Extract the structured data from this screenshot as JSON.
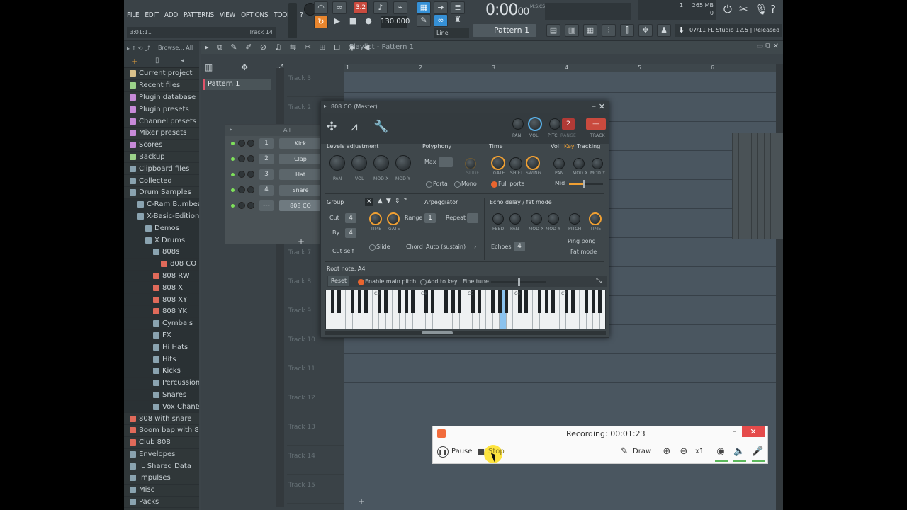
{
  "menu": [
    "FILE",
    "EDIT",
    "ADD",
    "PATTERNS",
    "VIEW",
    "OPTIONS",
    "TOOLS",
    "?"
  ],
  "hint": {
    "time": "3:01:11",
    "track": "Track 14"
  },
  "transport": {
    "bpm": "130.000",
    "snap_mode": "Line",
    "pattern": "Pattern 1",
    "counter": "0:00",
    "counter_fraction": "00",
    "counter_unit": "M:S:CS"
  },
  "memory": {
    "used": "265 MB",
    "count": "1",
    "zero": "0"
  },
  "news": {
    "date": "07/11",
    "text": "FL Studio 12.5 | Released"
  },
  "browser": {
    "toolbar_label": "Browse... All",
    "items": [
      {
        "label": "Current project",
        "indent": 0,
        "color": "#d9c08a"
      },
      {
        "label": "Recent files",
        "indent": 0,
        "color": "#9cd38a"
      },
      {
        "label": "Plugin database",
        "indent": 0,
        "color": "#c78ad9"
      },
      {
        "label": "Plugin presets",
        "indent": 0,
        "color": "#c78ad9"
      },
      {
        "label": "Channel presets",
        "indent": 0,
        "color": "#c78ad9"
      },
      {
        "label": "Mixer presets",
        "indent": 0,
        "color": "#c78ad9"
      },
      {
        "label": "Scores",
        "indent": 0,
        "color": "#c78ad9"
      },
      {
        "label": "Backup",
        "indent": 0,
        "color": "#9cd38a"
      },
      {
        "label": "Clipboard files",
        "indent": 0,
        "color": "#8aa3b0"
      },
      {
        "label": "Collected",
        "indent": 0,
        "color": "#8aa3b0"
      },
      {
        "label": "Drum Samples",
        "indent": 0,
        "color": "#8aa3b0"
      },
      {
        "label": "C-Ram B..mbeatz",
        "indent": 1,
        "color": "#8aa3b0"
      },
      {
        "label": "X-Basic-Edition",
        "indent": 1,
        "color": "#8aa3b0"
      },
      {
        "label": "Demos",
        "indent": 2,
        "color": "#8aa3b0"
      },
      {
        "label": "X Drums",
        "indent": 2,
        "color": "#8aa3b0"
      },
      {
        "label": "808s",
        "indent": 3,
        "color": "#8aa3b0"
      },
      {
        "label": "808 CO",
        "indent": 4,
        "color": "#e06a5a"
      },
      {
        "label": "808 RW",
        "indent": 3,
        "color": "#e06a5a"
      },
      {
        "label": "808 X",
        "indent": 3,
        "color": "#e06a5a"
      },
      {
        "label": "808 XY",
        "indent": 3,
        "color": "#e06a5a"
      },
      {
        "label": "808 YK",
        "indent": 3,
        "color": "#e06a5a"
      },
      {
        "label": "Cymbals",
        "indent": 3,
        "color": "#8aa3b0"
      },
      {
        "label": "FX",
        "indent": 3,
        "color": "#8aa3b0"
      },
      {
        "label": "Hi Hats",
        "indent": 3,
        "color": "#8aa3b0"
      },
      {
        "label": "Hits",
        "indent": 3,
        "color": "#8aa3b0"
      },
      {
        "label": "Kicks",
        "indent": 3,
        "color": "#8aa3b0"
      },
      {
        "label": "Percussion",
        "indent": 3,
        "color": "#8aa3b0"
      },
      {
        "label": "Snares",
        "indent": 3,
        "color": "#8aa3b0"
      },
      {
        "label": "Vox Chants",
        "indent": 3,
        "color": "#8aa3b0"
      },
      {
        "label": "808 with snare",
        "indent": 0,
        "color": "#e06a5a"
      },
      {
        "label": "Boom bap with 808",
        "indent": 0,
        "color": "#e06a5a"
      },
      {
        "label": "Club 808",
        "indent": 0,
        "color": "#e06a5a"
      },
      {
        "label": "Envelopes",
        "indent": 0,
        "color": "#8aa3b0"
      },
      {
        "label": "IL Shared Data",
        "indent": 0,
        "color": "#8aa3b0"
      },
      {
        "label": "Impulses",
        "indent": 0,
        "color": "#8aa3b0"
      },
      {
        "label": "Misc",
        "indent": 0,
        "color": "#8aa3b0"
      },
      {
        "label": "Packs",
        "indent": 0,
        "color": "#8aa3b0"
      }
    ]
  },
  "playlist": {
    "title": "Playlist - Pattern 1",
    "pattern_item": "Pattern 1",
    "ruler": [
      "1",
      "2",
      "3",
      "4",
      "5",
      "6"
    ],
    "tracks": [
      "Track 3",
      "Track 2",
      "",
      "",
      "",
      "",
      "Track 7",
      "Track 8",
      "Track 9",
      "Track 10",
      "Track 11",
      "Track 12",
      "Track 13",
      "Track 14",
      "Track 15"
    ]
  },
  "rack": {
    "filter": "All",
    "channels": [
      {
        "num": "1",
        "name": "Kick"
      },
      {
        "num": "2",
        "name": "Clap"
      },
      {
        "num": "3",
        "name": "Hat"
      },
      {
        "num": "4",
        "name": "Snare"
      },
      {
        "num": "---",
        "name": "808 CO"
      }
    ],
    "add": "+"
  },
  "plugin": {
    "title": "808 CO (Master)",
    "header_knobs": [
      "PAN",
      "VOL",
      "PITCH",
      "RANGE",
      "TRACK"
    ],
    "range_value": "2",
    "track_value": "---",
    "levels": {
      "title": "Levels adjustment",
      "knobs": [
        "PAN",
        "VOL",
        "MOD X",
        "MOD Y"
      ]
    },
    "polyphony": {
      "title": "Polyphony",
      "max_label": "Max",
      "slide_label": "SLIDE",
      "porta": "Porta",
      "mono": "Mono"
    },
    "time": {
      "title": "Time",
      "knobs": [
        "GATE",
        "SHIFT",
        "SWING"
      ],
      "full_porta": "Full porta"
    },
    "tracking": {
      "tabs": [
        "Vol",
        "Key",
        "Tracking"
      ],
      "knobs": [
        "PAN",
        "MOD X",
        "MOD Y"
      ],
      "mid": "Mid"
    },
    "group": {
      "title": "Group",
      "cut_label": "Cut",
      "cut_value": "4",
      "by_label": "By",
      "by_value": "4",
      "cut_self": "Cut self"
    },
    "arp": {
      "title": "Arpeggiator",
      "range_label": "Range",
      "range_value": "1",
      "repeat_label": "Repeat",
      "knobs": [
        "TIME",
        "GATE"
      ],
      "slide": "Slide",
      "chord_label": "Chord",
      "chord_value": "Auto (sustain)"
    },
    "echo": {
      "title": "Echo delay / fat mode",
      "knobs": [
        "FEED",
        "PAN",
        "MOD X",
        "MOD Y",
        "PITCH",
        "TIME"
      ],
      "echoes_label": "Echoes",
      "echoes_value": "4",
      "ping_pong": "Ping pong",
      "fat_mode": "Fat mode"
    },
    "root": {
      "label": "Root note: A4",
      "reset": "Reset",
      "enable_main_pitch": "Enable main pitch",
      "add_to_key": "Add to key",
      "fine_tune": "Fine tune"
    },
    "octaves": [
      "C3",
      "C4",
      "C5",
      "C6",
      "C7"
    ]
  },
  "recorder": {
    "status": "Recording:  00:01:23",
    "pause": "Pause",
    "stop": "Stop",
    "draw": "Draw",
    "zoom": "x1"
  }
}
